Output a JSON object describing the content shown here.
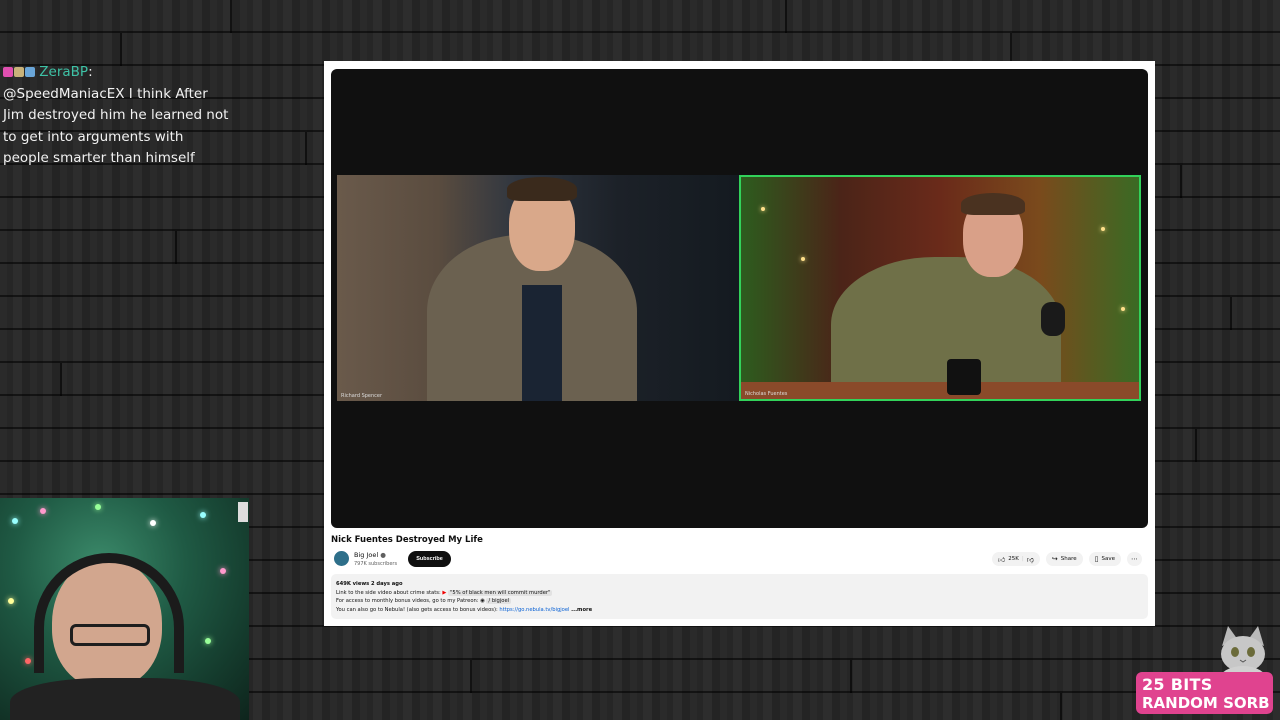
{
  "chat": {
    "username": "ZeraBP",
    "separator": ":",
    "message": "@SpeedManiacEX I think After Jim destroyed him he learned not to get into arguments with people smarter than himself",
    "colors": {
      "username": "#3ec2a6"
    }
  },
  "video": {
    "title": "Nick Fuentes Destroyed My Life",
    "participants": [
      {
        "name": "Richard Spencer"
      },
      {
        "name": "Nicholas Fuentes"
      }
    ]
  },
  "channel": {
    "name": "Big Joel",
    "verified_icon": "check-circle-icon",
    "subscribers": "797K subscribers",
    "subscribe_label": "Subscribe"
  },
  "actions": {
    "like_count": "25K",
    "share_label": "Share",
    "save_label": "Save"
  },
  "description": {
    "meta": "649K views  2 days ago",
    "line1_text": "Link to the side video about crime stats:",
    "line1_link": "\"5% of black men will commit murder\"",
    "line2_text": "For access to monthly bonus videos, go to my Patreon:",
    "line2_link": "/ bigjoel",
    "line3_text": "You can also go to Nebula! (also gets access to bonus videos):",
    "line3_link": "https://go.nebula.tv/bigjoel",
    "more_label": "...more"
  },
  "bits_panel": {
    "line1": "25 BITS",
    "line2": "RANDOM SORB",
    "color": "#e0438f"
  }
}
